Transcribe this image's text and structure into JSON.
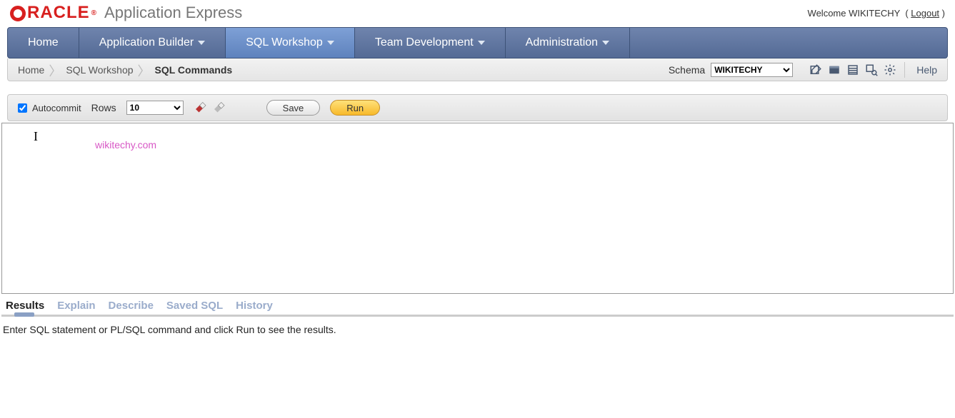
{
  "brand": {
    "logo_text": "RACLE",
    "app_title": "Application Express"
  },
  "welcome": {
    "prefix": "Welcome ",
    "user": "WIKITECHY",
    "logout": "Logout"
  },
  "nav": {
    "home": "Home",
    "app_builder": "Application Builder",
    "sql_workshop": "SQL Workshop",
    "team_dev": "Team Development",
    "admin": "Administration"
  },
  "breadcrumb": {
    "home": "Home",
    "sql_workshop": "SQL Workshop",
    "sql_commands": "SQL Commands"
  },
  "subbar": {
    "schema_label": "Schema",
    "schema_value": "WIKITECHY",
    "help": "Help"
  },
  "toolbar": {
    "autocommit": "Autocommit",
    "rows_label": "Rows",
    "rows_value": "10",
    "save": "Save",
    "run": "Run"
  },
  "editor": {
    "watermark": "wikitechy.com"
  },
  "tabs": {
    "results": "Results",
    "explain": "Explain",
    "describe": "Describe",
    "saved_sql": "Saved SQL",
    "history": "History"
  },
  "results_body": "Enter SQL statement or PL/SQL command and click Run to see the results."
}
